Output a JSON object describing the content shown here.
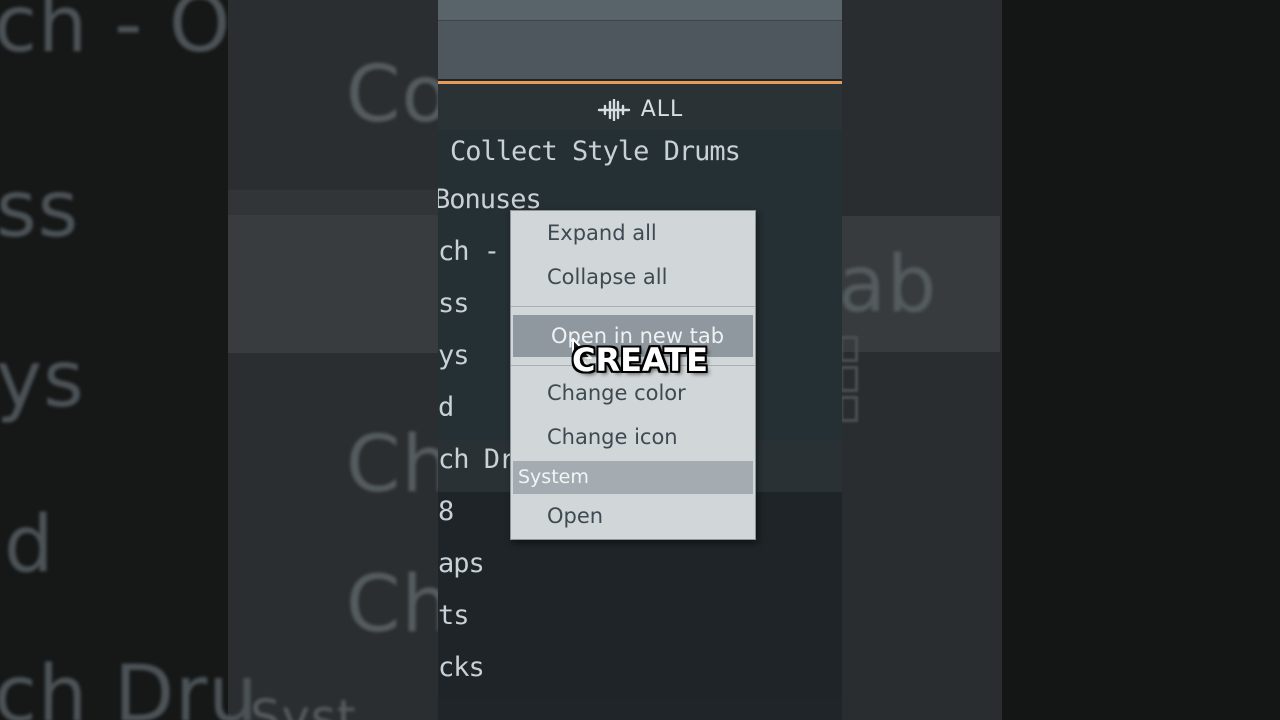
{
  "background_left": {
    "fragments": [
      "ch - O",
      "Co",
      "ss",
      "ys",
      "d",
      "Ch",
      "Ch",
      "ch Dru",
      "Syst"
    ]
  },
  "background_right": {
    "fragments": [
      "ab"
    ]
  },
  "browser": {
    "filter_label": "ALL",
    "items": [
      "Collect Style Drums",
      " Bonuses",
      "ch - O",
      "ss",
      "ys",
      "d",
      "ch Dru",
      "8",
      "aps",
      "ts",
      "cks"
    ]
  },
  "context_menu": {
    "items": {
      "expand_all": "Expand all",
      "collapse_all": "Collapse all",
      "open_in_new_tab": "Open in new tab",
      "change_color": "Change color",
      "change_icon": "Change icon",
      "system_header": "System",
      "open": "Open"
    }
  },
  "caption": "CREATE",
  "colors": {
    "accent": "#e59b55",
    "menu_bg": "#d1d6d8",
    "menu_hover": "#8e989e"
  }
}
